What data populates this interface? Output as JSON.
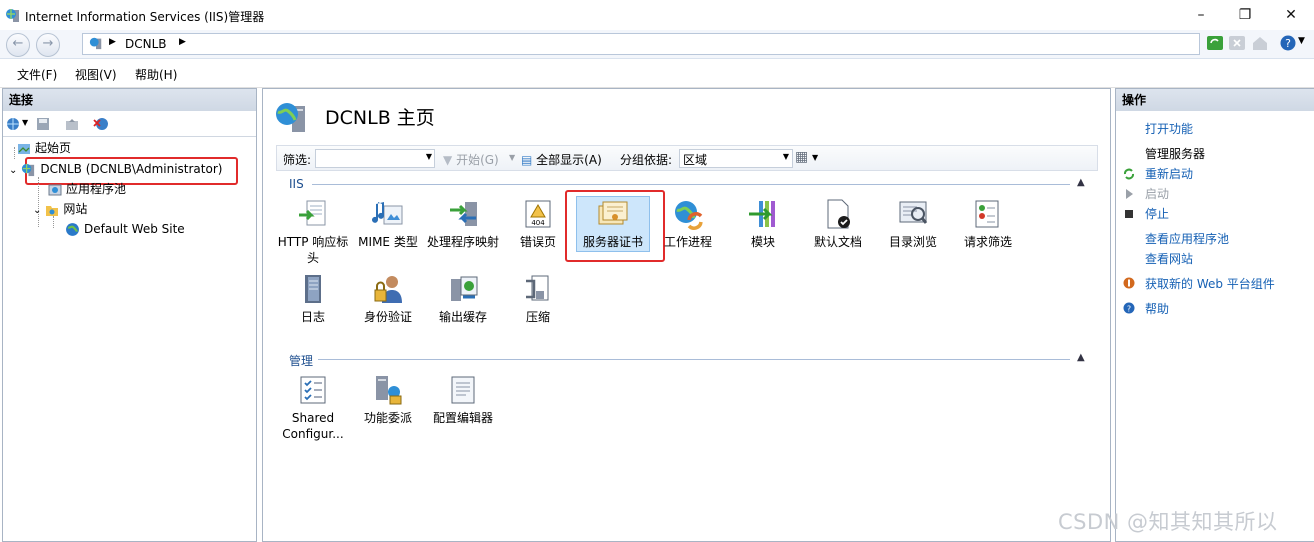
{
  "window": {
    "title": "Internet Information Services (IIS)管理器"
  },
  "address": {
    "path": [
      "DCNLB"
    ]
  },
  "menu": [
    "文件(F)",
    "视图(V)",
    "帮助(H)"
  ],
  "connections": {
    "header": "连接",
    "tree": [
      {
        "label": "起始页"
      },
      {
        "label": "DCNLB (DCNLB\\Administrator)"
      },
      {
        "label": "应用程序池"
      },
      {
        "label": "网站"
      },
      {
        "label": "Default Web Site"
      }
    ]
  },
  "main": {
    "title": "DCNLB 主页",
    "filter": {
      "label": "筛选:",
      "value": "",
      "start": "开始(G)",
      "show_all": "全部显示(A)",
      "group_label": "分组依据:",
      "group_value": "区域"
    },
    "sections": [
      {
        "name": "IIS",
        "features": [
          {
            "label": "HTTP 响应标头",
            "icon": "http-headers-icon"
          },
          {
            "label": "MIME 类型",
            "icon": "mime-types-icon"
          },
          {
            "label": "处理程序映射",
            "icon": "handler-mappings-icon"
          },
          {
            "label": "错误页",
            "icon": "error-pages-icon"
          },
          {
            "label": "服务器证书",
            "icon": "server-certificates-icon"
          },
          {
            "label": "工作进程",
            "icon": "worker-processes-icon"
          },
          {
            "label": "模块",
            "icon": "modules-icon"
          },
          {
            "label": "默认文档",
            "icon": "default-document-icon"
          },
          {
            "label": "目录浏览",
            "icon": "directory-browsing-icon"
          },
          {
            "label": "请求筛选",
            "icon": "request-filtering-icon"
          },
          {
            "label": "日志",
            "icon": "logging-icon"
          },
          {
            "label": "身份验证",
            "icon": "authentication-icon"
          },
          {
            "label": "输出缓存",
            "icon": "output-caching-icon"
          },
          {
            "label": "压缩",
            "icon": "compression-icon"
          }
        ]
      },
      {
        "name": "管理",
        "features": [
          {
            "label": "Shared Configur...",
            "icon": "shared-configuration-icon"
          },
          {
            "label": "功能委派",
            "icon": "feature-delegation-icon"
          },
          {
            "label": "配置编辑器",
            "icon": "configuration-editor-icon"
          }
        ]
      }
    ]
  },
  "actions": {
    "header": "操作",
    "open_feature": "打开功能",
    "manage_server": "管理服务器",
    "restart": "重新启动",
    "start": "启动",
    "stop": "停止",
    "view_app_pools": "查看应用程序池",
    "view_sites": "查看网站",
    "get_web_platform": "获取新的 Web 平台组件",
    "help": "帮助"
  },
  "watermark": "CSDN @知其知其所以",
  "colors": {
    "link": "#1560b4",
    "highlight": "#e12b2b",
    "panel_header": "#d5dde8"
  }
}
